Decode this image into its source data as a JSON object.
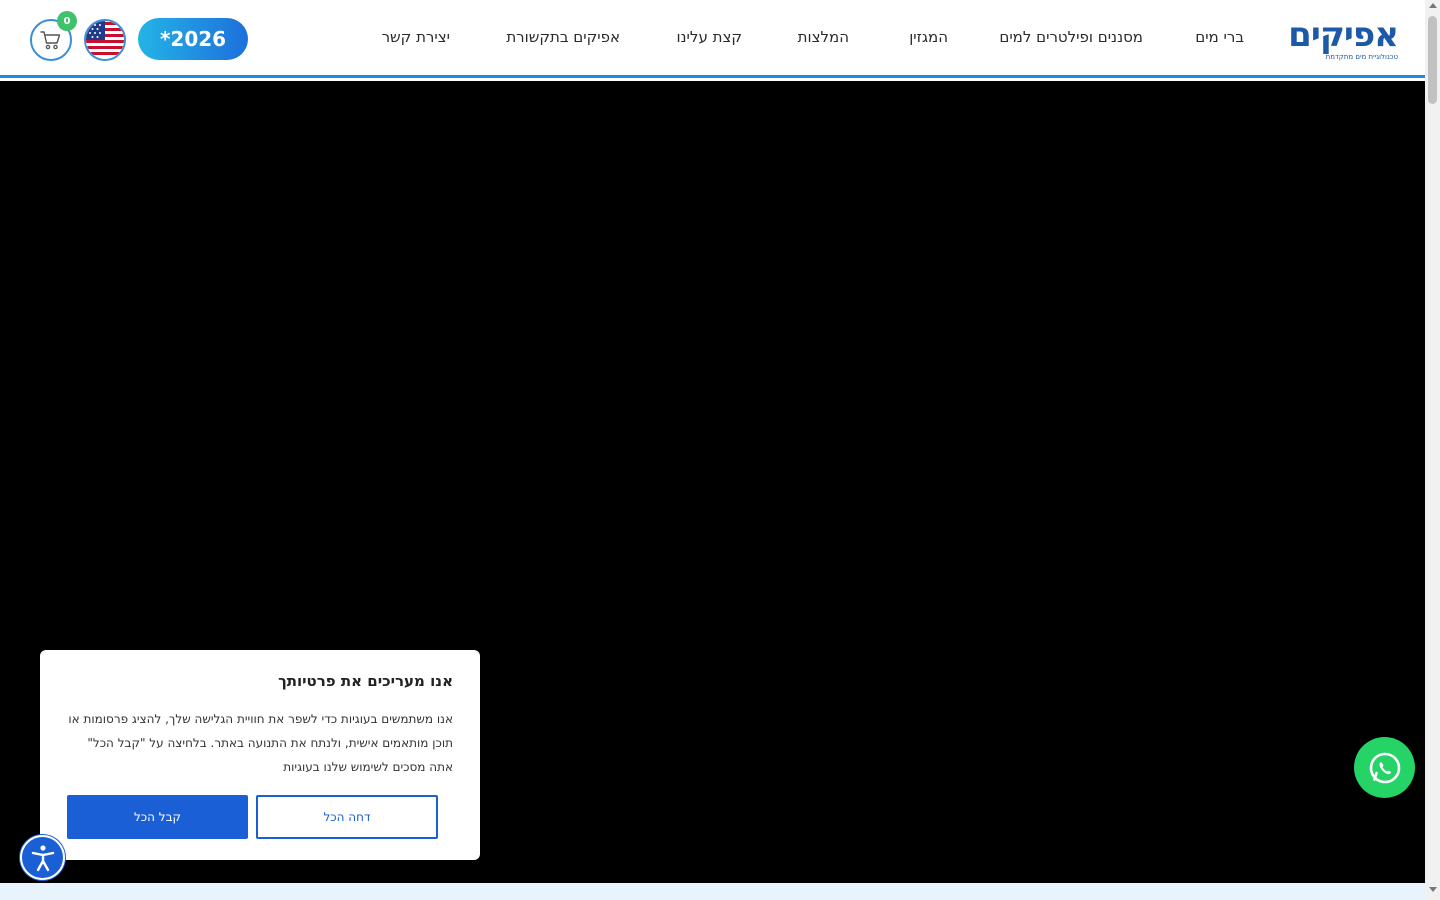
{
  "header": {
    "logo": {
      "text": "אפיקים",
      "tagline": "טכנולוגיית מים מתקדמת"
    },
    "nav": [
      {
        "label": "ברי מים"
      },
      {
        "label": "מסננים ופילטרים למים"
      },
      {
        "label": "המגזין"
      },
      {
        "label": "המלצות"
      },
      {
        "label": "קצת עלינו"
      },
      {
        "label": "אפיקים בתקשורת"
      },
      {
        "label": "יצירת קשר"
      }
    ],
    "phone_button": "*2026",
    "language_icon": "us-flag-icon",
    "cart": {
      "icon": "cart-icon",
      "count": "0"
    }
  },
  "hero": {
    "background": "#000000"
  },
  "cookie_banner": {
    "title": "אנו מעריכים את פרטיותך",
    "text": "אנו משתמשים בעוגיות כדי לשפר את חוויית הגלישה שלך, להציג פרסומות או תוכן מותאמים אישית, ולנתח את התנועה באתר. בלחיצה על \"קבל הכל\" אתה מסכים לשימוש שלנו בעוגיות",
    "reject_label": "דחה הכל",
    "accept_label": "קבל הכל"
  },
  "floating": {
    "whatsapp_icon": "whatsapp-icon",
    "accessibility_icon": "accessibility-icon"
  },
  "colors": {
    "brand": "#1c5aa8",
    "accent": "#1a5fd6",
    "whatsapp": "#25d366",
    "badge": "#3fc26b"
  }
}
